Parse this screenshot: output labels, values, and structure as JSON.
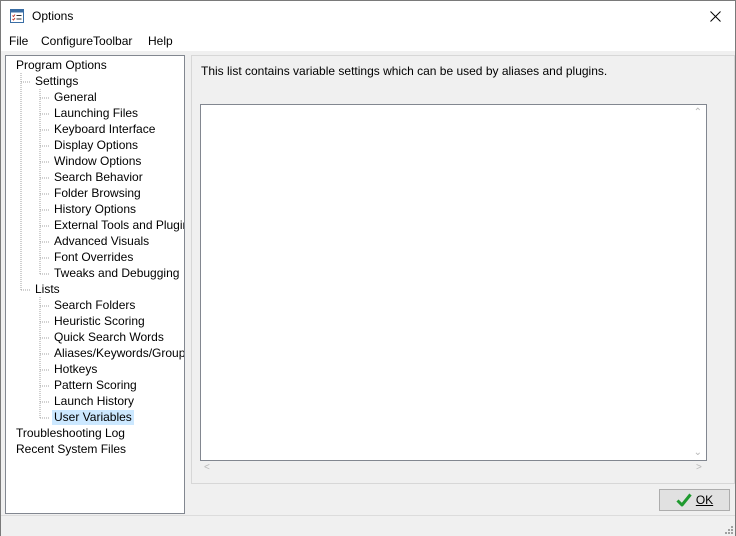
{
  "window": {
    "title": "Options",
    "icon": "checklist-icon",
    "close_icon": "close-icon"
  },
  "menu": [
    {
      "label": "File"
    },
    {
      "label": "ConfigureToolbar"
    },
    {
      "label": "Help"
    }
  ],
  "tree": [
    {
      "label": "Program Options",
      "level": 0
    },
    {
      "label": "Settings",
      "level": 1
    },
    {
      "label": "General",
      "level": 2
    },
    {
      "label": "Launching Files",
      "level": 2
    },
    {
      "label": "Keyboard Interface",
      "level": 2
    },
    {
      "label": "Display Options",
      "level": 2
    },
    {
      "label": "Window Options",
      "level": 2
    },
    {
      "label": "Search Behavior",
      "level": 2
    },
    {
      "label": "Folder Browsing",
      "level": 2
    },
    {
      "label": "History Options",
      "level": 2
    },
    {
      "label": "External Tools and Plugins",
      "level": 2
    },
    {
      "label": "Advanced Visuals",
      "level": 2
    },
    {
      "label": "Font Overrides",
      "level": 2
    },
    {
      "label": "Tweaks and Debugging",
      "level": 2
    },
    {
      "label": "Lists",
      "level": 1
    },
    {
      "label": "Search Folders",
      "level": 2
    },
    {
      "label": "Heuristic Scoring",
      "level": 2
    },
    {
      "label": "Quick Search Words",
      "level": 2
    },
    {
      "label": "Aliases/Keywords/Groups",
      "level": 2
    },
    {
      "label": "Hotkeys",
      "level": 2
    },
    {
      "label": "Pattern Scoring",
      "level": 2
    },
    {
      "label": "Launch History",
      "level": 2
    },
    {
      "label": "User Variables",
      "level": 2,
      "selected": true
    },
    {
      "label": "Troubleshooting Log",
      "level": 0
    },
    {
      "label": "Recent System Files",
      "level": 0
    }
  ],
  "panel": {
    "description": "This list contains variable settings which can be used by aliases and plugins.",
    "list_items": []
  },
  "ok_button": {
    "label": "OK",
    "icon": "checkmark-icon",
    "icon_color": "#1f9a2f"
  },
  "colors": {
    "selection": "#cce8ff"
  }
}
